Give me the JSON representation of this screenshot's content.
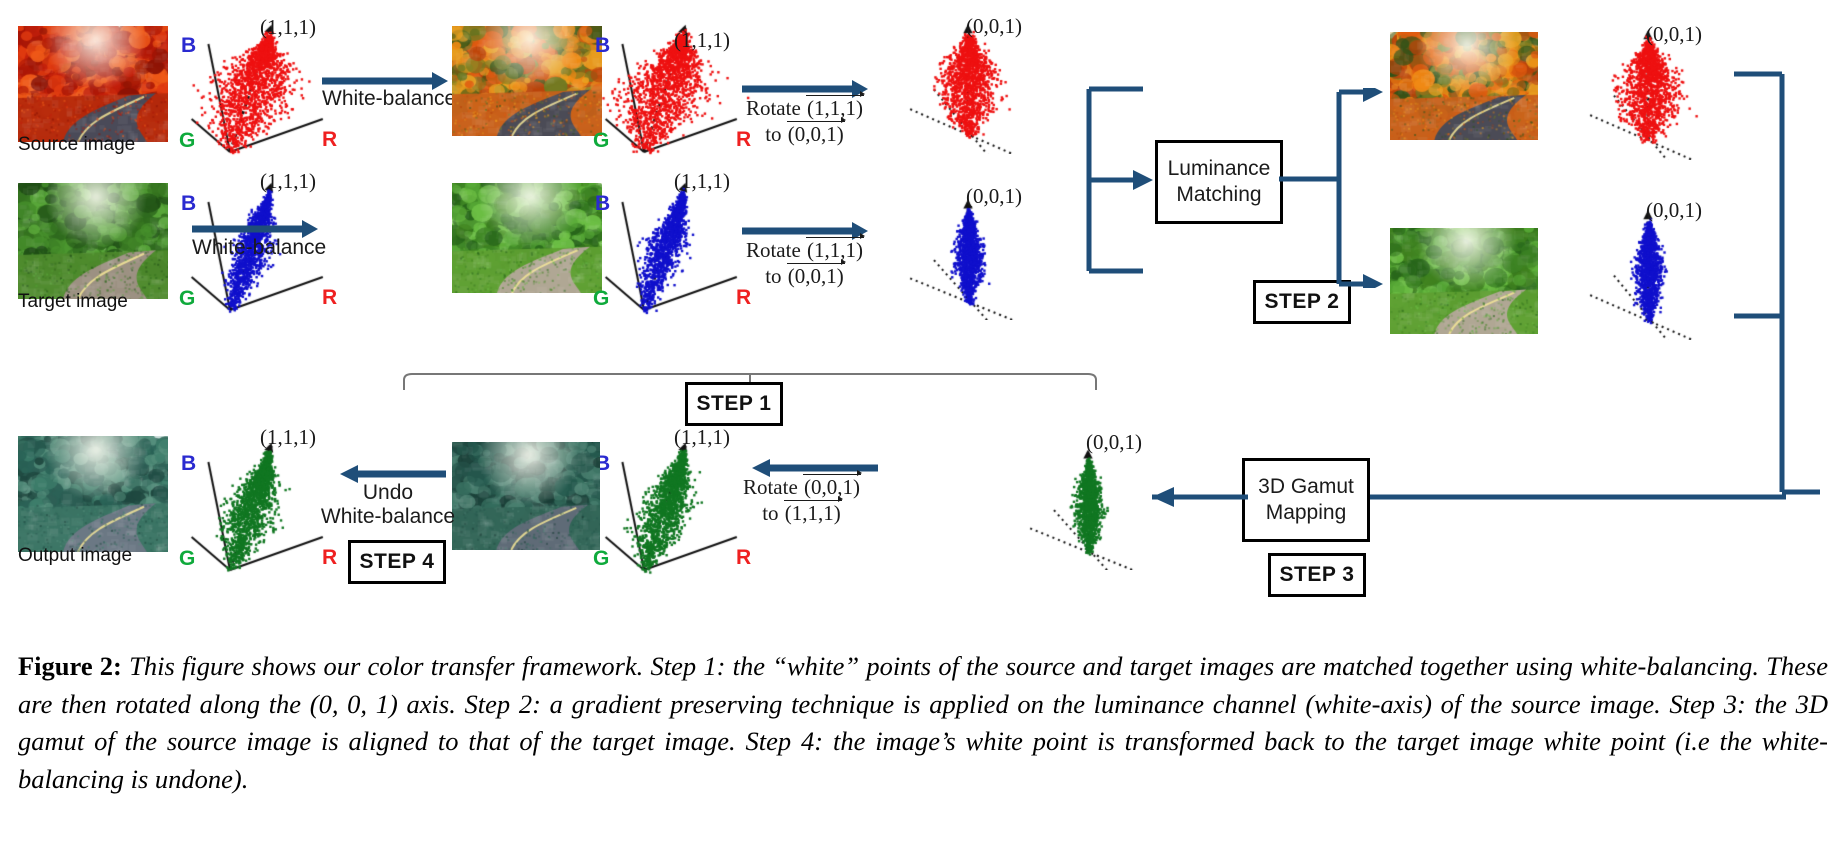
{
  "figure": {
    "label": "Figure 2:",
    "caption": "This figure shows our color transfer framework. Step 1: the “white” points of the source and target images are matched together using white-balancing. These are then rotated along the (0, 0, 1) axis. Step 2: a gradient preserving technique is applied on the luminance channel (white-axis) of the source image. Step 3: the 3D gamut of the source image is aligned to that of the target image. Step 4: the image’s white point is transformed back to the target image white point (i.e the white-balancing is undone)."
  },
  "image_captions": {
    "source": "Source image",
    "target": "Target image",
    "output": "Output image"
  },
  "axes": {
    "r": "R",
    "g": "G",
    "b": "B"
  },
  "vectors": {
    "white_axis": "(1,1,1)",
    "blue_axis": "(0,0,1)"
  },
  "arrows": {
    "white_balance": "White-balance",
    "undo_white_balance_line1": "Undo",
    "undo_white_balance_line2": "White-balance",
    "rotate_fwd_prefix": "Rotate",
    "rotate_fwd_from": "(1,1,1)",
    "rotate_fwd_to_prefix": "to",
    "rotate_fwd_to": "(0,0,1)",
    "rotate_back_prefix": "Rotate",
    "rotate_back_from": "(0,0,1)",
    "rotate_back_to_prefix": "to",
    "rotate_back_to": "(1,1,1)"
  },
  "process_boxes": [
    {
      "id": "luminance-matching",
      "line1": "Luminance",
      "line2": "Matching"
    },
    {
      "id": "gamut-mapping",
      "line1": "3D Gamut",
      "line2": "Mapping"
    }
  ],
  "steps": [
    {
      "id": "step-1",
      "label": "STEP 1"
    },
    {
      "id": "step-2",
      "label": "STEP 2"
    },
    {
      "id": "step-3",
      "label": "STEP 3"
    },
    {
      "id": "step-4",
      "label": "STEP 4"
    }
  ],
  "colors": {
    "arrow_blue": "#1f4e79",
    "point_red": "#ee1111",
    "point_blue": "#1010cc",
    "point_green": "#117722",
    "axis_r": "#ef2020",
    "axis_g": "#0faa3c",
    "axis_b": "#2a2ad0",
    "box_border": "#000000"
  },
  "photos": [
    {
      "id": "source-photo",
      "scene": "autumn-red-forest-road"
    },
    {
      "id": "source-wb-photo",
      "scene": "autumn-orange-forest-road"
    },
    {
      "id": "target-photo",
      "scene": "green-forest-dirt-path"
    },
    {
      "id": "target-wb-photo",
      "scene": "green-forest-dirt-path-bright"
    },
    {
      "id": "lum-source-photo",
      "scene": "autumn-orange-forest-road"
    },
    {
      "id": "lum-target-photo",
      "scene": "green-forest-dirt-path-bright"
    },
    {
      "id": "output-photo",
      "scene": "teal-forest-road"
    },
    {
      "id": "pre-undo-photo",
      "scene": "teal-forest-road-dark"
    }
  ],
  "scatter_plots": [
    {
      "id": "source-gamut",
      "color": "point_red",
      "axis": "white_axis",
      "orientation": "rgb"
    },
    {
      "id": "source-wb-gamut",
      "color": "point_red",
      "axis": "white_axis",
      "orientation": "rgb"
    },
    {
      "id": "source-rot-gamut",
      "color": "point_red",
      "axis": "blue_axis",
      "orientation": "rotated"
    },
    {
      "id": "target-gamut",
      "color": "point_blue",
      "axis": "white_axis",
      "orientation": "rgb"
    },
    {
      "id": "target-wb-gamut",
      "color": "point_blue",
      "axis": "white_axis",
      "orientation": "rgb"
    },
    {
      "id": "target-rot-gamut",
      "color": "point_blue",
      "axis": "blue_axis",
      "orientation": "rotated"
    },
    {
      "id": "lum-source-gamut",
      "color": "point_red",
      "axis": "blue_axis",
      "orientation": "rotated"
    },
    {
      "id": "lum-target-gamut",
      "color": "point_blue",
      "axis": "blue_axis",
      "orientation": "rotated"
    },
    {
      "id": "gamut-mapped",
      "color": "point_green",
      "axis": "blue_axis",
      "orientation": "rotated"
    },
    {
      "id": "output-rot-gamut",
      "color": "point_green",
      "axis": "white_axis",
      "orientation": "rgb"
    },
    {
      "id": "output-gamut",
      "color": "point_green",
      "axis": "white_axis",
      "orientation": "rgb"
    }
  ]
}
